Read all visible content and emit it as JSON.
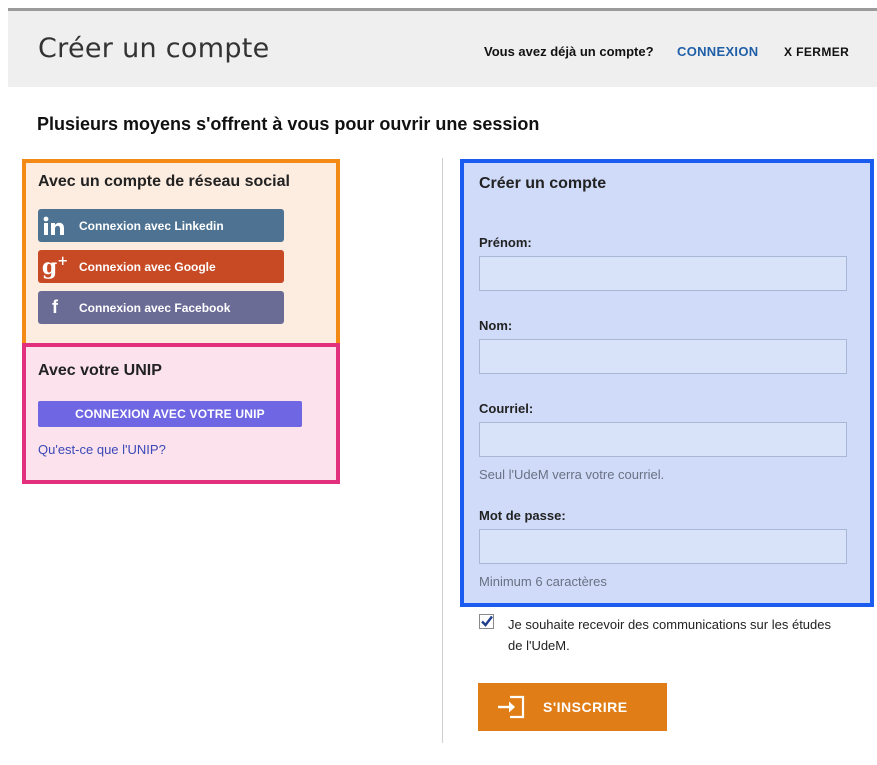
{
  "header": {
    "title": "Créer un compte",
    "already_text": "Vous avez déjà un compte?",
    "login_link": "CONNEXION",
    "close_label": "X FERMER"
  },
  "headline": "Plusieurs moyens s'offrent à vous pour ouvrir une session",
  "social": {
    "title": "Avec un compte de réseau social",
    "buttons": [
      {
        "label": "Connexion avec Linkedin",
        "icon": "linkedin-icon",
        "color": "#4e7291"
      },
      {
        "label": "Connexion avec Google",
        "icon": "google-plus-icon",
        "color": "#c84a25"
      },
      {
        "label": "Connexion avec Facebook",
        "icon": "facebook-icon",
        "color": "#6b6c96"
      }
    ]
  },
  "unip": {
    "title": "Avec votre UNIP",
    "button": "CONNEXION AVEC VOTRE UNIP",
    "link": "Qu'est-ce que l'UNIP?"
  },
  "form": {
    "title": "Créer un compte",
    "fields": [
      {
        "label": "Prénom:",
        "value": "",
        "hint": ""
      },
      {
        "label": "Nom:",
        "value": "",
        "hint": ""
      },
      {
        "label": "Courriel:",
        "value": "",
        "hint": "Seul l'UdeM verra votre courriel."
      },
      {
        "label": "Mot de passe:",
        "value": "",
        "hint": "Minimum 6 caractères"
      }
    ],
    "newsletter_checked": true,
    "newsletter_label": "Je souhaite recevoir des communications sur les études de l'UdeM.",
    "submit": "S'INSCRIRE"
  },
  "colors": {
    "social_border": "#f28a15",
    "unip_border": "#e2307f",
    "form_border": "#1b5cf0",
    "submit_bg": "#e07d17",
    "link": "#1f5fa8"
  }
}
